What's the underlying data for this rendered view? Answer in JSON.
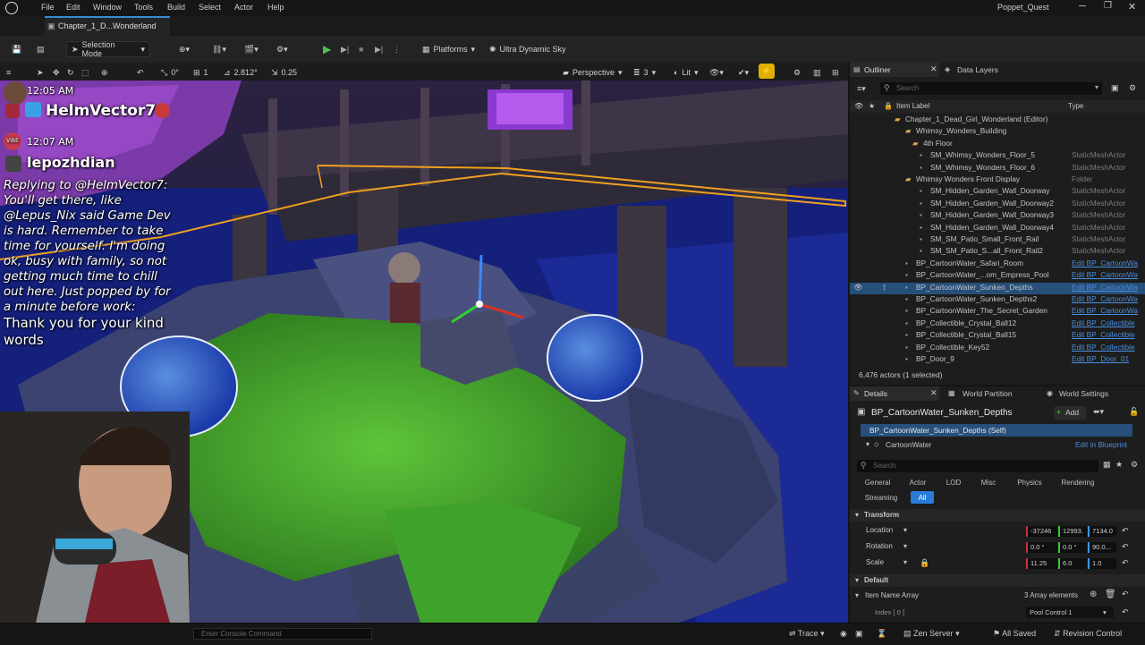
{
  "menu": [
    "File",
    "Edit",
    "Window",
    "Tools",
    "Build",
    "Select",
    "Actor",
    "Help"
  ],
  "project_name": "Poppet_Quest",
  "level_tab": "Chapter_1_D...Wonderland",
  "toolbar": {
    "selection_mode": "Selection Mode",
    "platforms": "Platforms",
    "sky": "Ultra Dynamic Sky"
  },
  "viewport_toolbar": {
    "grid_angle": "0°",
    "grid_step": "1",
    "snap_value": "2.812°",
    "scale_snap": "0.25",
    "perspective": "Perspective",
    "speed": "3",
    "lit": "Lit"
  },
  "chat": {
    "msg1_time": "12:05 AM",
    "msg1_user": "HelmVector7",
    "msg2_time": "12:07 AM",
    "msg2_user": "lepozhdian",
    "msg2_line1": "Replying to @HelmVector7:",
    "msg2_line2": "You'll get there, like",
    "msg2_line3": "@Lepus_Nix said Game Dev",
    "msg2_line4": "is hard. Remember to take",
    "msg2_line5": "time for yourself. I'm doing",
    "msg2_line6": "ok, busy with family, so not",
    "msg2_line7": "getting much time to chill",
    "msg2_line8": "out here. Just popped by for",
    "msg2_line9": "a minute before work:",
    "msg2_line10": "Thank you for your kind",
    "msg2_line11": "words"
  },
  "outliner": {
    "tab_outliner": "Outliner",
    "tab_data_layers": "Data Layers",
    "search_placeholder": "Search",
    "col_item_label": "Item Label",
    "col_type": "Type",
    "rows": [
      {
        "label": "Chapter_1_Dead_Girl_Wonderland (Editor)",
        "type": ""
      },
      {
        "label": "Whimsy_Wonders_Building",
        "type": ""
      },
      {
        "label": "4th Floor",
        "type": ""
      },
      {
        "label": "SM_Whimsy_Wonders_Floor_5",
        "type": "StaticMeshActor"
      },
      {
        "label": "SM_Whimsy_Wonders_Floor_6",
        "type": "StaticMeshActor"
      },
      {
        "label": "Whimsy Wonders Front Display",
        "type": "Folder"
      },
      {
        "label": "SM_Hidden_Garden_Wall_Doorway",
        "type": "StaticMeshActor"
      },
      {
        "label": "SM_Hidden_Garden_Wall_Doorway2",
        "type": "StaticMeshActor"
      },
      {
        "label": "SM_Hidden_Garden_Wall_Doorway3",
        "type": "StaticMeshActor"
      },
      {
        "label": "SM_Hidden_Garden_Wall_Doorway4",
        "type": "StaticMeshActor"
      },
      {
        "label": "SM_SM_Patio_Small_Front_Rail",
        "type": "StaticMeshActor"
      },
      {
        "label": "SM_SM_Patio_S...all_Front_Rail2",
        "type": "StaticMeshActor"
      },
      {
        "label": "BP_CartoonWater_Safari_Room",
        "type": "Edit BP_CartoonWa"
      },
      {
        "label": "BP_CartoonWater_...om_Empress_Pool",
        "type": "Edit BP_CartoonWa"
      },
      {
        "label": "BP_CartoonWater_Sunken_Depths",
        "type": "Edit BP_CartoonWa"
      },
      {
        "label": "BP_CartoonWater_Sunken_Depths2",
        "type": "Edit BP_CartoonWa"
      },
      {
        "label": "BP_CartoonWater_The_Secret_Garden",
        "type": "Edit BP_CartoonWa"
      },
      {
        "label": "BP_Collectible_Crystal_Ball12",
        "type": "Edit BP_Collectible"
      },
      {
        "label": "BP_Collectible_Crystal_Ball15",
        "type": "Edit BP_Collectible"
      },
      {
        "label": "BP_Collectible_Key52",
        "type": "Edit BP_Collectible"
      },
      {
        "label": "BP_Door_9",
        "type": "Edit BP_Door_01"
      }
    ],
    "actor_count": "6,476 actors (1 selected)"
  },
  "details": {
    "tab_details": "Details",
    "tab_world_partition": "World Partition",
    "tab_world_settings": "World Settings",
    "actor_name": "BP_CartoonWater_Sunken_Depths",
    "add_label": "Add",
    "self_label": "BP_CartoonWater_Sunken_Depths (Self)",
    "component": "CartoonWater",
    "edit_in_blueprint": "Edit in Blueprint",
    "search_placeholder": "Search",
    "filters": [
      "General",
      "Actor",
      "LOD",
      "Misc",
      "Physics",
      "Rendering",
      "Streaming",
      "All"
    ],
    "transform_header": "Transform",
    "location_label": "Location",
    "location": [
      "-37246",
      "12993.",
      "7134.0"
    ],
    "rotation_label": "Rotation",
    "rotation": [
      "0.0 °",
      "0.0 °",
      "90.0..."
    ],
    "scale_label": "Scale",
    "scale": [
      "11.25",
      "6.0",
      "1.0"
    ],
    "default_header": "Default",
    "item_name_array": "Item Name Array",
    "array_elements": "3 Array elements",
    "index_label": "Index [ 0 ]",
    "index_value": "Pool Control 1"
  },
  "statusbar": {
    "console_placeholder": "Enter Console Command",
    "trace": "Trace",
    "zen_server": "Zen Server",
    "all_saved": "All Saved",
    "revision_control": "Revision Control"
  }
}
